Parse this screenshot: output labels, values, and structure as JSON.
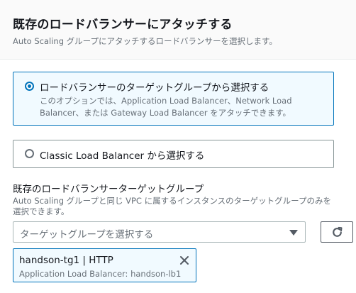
{
  "header": {
    "title": "既存のロードバランサーにアタッチする",
    "subtitle": "Auto Scaling グループにアタッチするロードバランサーを選択します。"
  },
  "options": [
    {
      "label": "ロードバランサーのターゲットグループから選択する",
      "description": "このオプションでは、Application Load Balancer、Network Load Balancer、または Gateway Load Balancer をアタッチできます。",
      "selected": true
    },
    {
      "label": "Classic Load Balancer から選択する",
      "selected": false
    }
  ],
  "target_group_field": {
    "label": "既存のロードバランサーターゲットグループ",
    "description": "Auto Scaling グループと同じ VPC に属するインスタンスのターゲットグループのみを選択できます。",
    "placeholder": "ターゲットグループを選択する"
  },
  "selected_token": {
    "title": "handson-tg1 | HTTP",
    "subtitle": "Application Load Balancer: handson-lb1"
  },
  "icons": {
    "caret": "caret-down-icon",
    "refresh": "refresh-icon",
    "close": "close-icon"
  },
  "colors": {
    "accent": "#0073bb",
    "selected_bg": "#f1faff"
  }
}
